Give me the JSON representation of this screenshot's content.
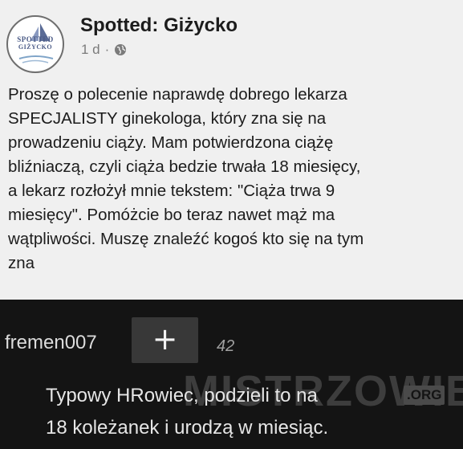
{
  "post": {
    "avatar_line1": "SPOTTED",
    "avatar_line2": "GIŻYCKO",
    "page_name": "Spotted: Giżycko",
    "time": "1 d",
    "separator": "·",
    "privacy_icon": "globe-icon",
    "body_lines": [
      "Proszę o polecenie naprawdę dobrego lekarza",
      "SPECJALISTY ginekologa, który zna się na",
      "prowadzeniu ciąży. Mam potwierdzona ciążę",
      "bliźniaczą, czyli ciąża bedzie trwała 18 miesięcy,",
      "a lekarz rozłożył mnie tekstem: \"Ciąża trwa 9",
      "miesięcy\". Pomóżcie bo teraz nawet mąż ma",
      "wątpliwości. Muszę znaleźć kogoś kto się na tym",
      "zna"
    ]
  },
  "comment": {
    "username": "fremen007",
    "plus_label": "+",
    "votes": "42",
    "text_lines": [
      "Typowy HRowiec, podzieli to na",
      "18 koleżanek i urodzą w miesiąc."
    ]
  },
  "watermark": {
    "text": "MISTRZOWIE",
    "suffix": ".ORG"
  },
  "colors": {
    "post_background": "#f0f0f0",
    "comment_background": "#141414",
    "button_background": "#383838",
    "avatar_blue": "#4a5a86"
  }
}
